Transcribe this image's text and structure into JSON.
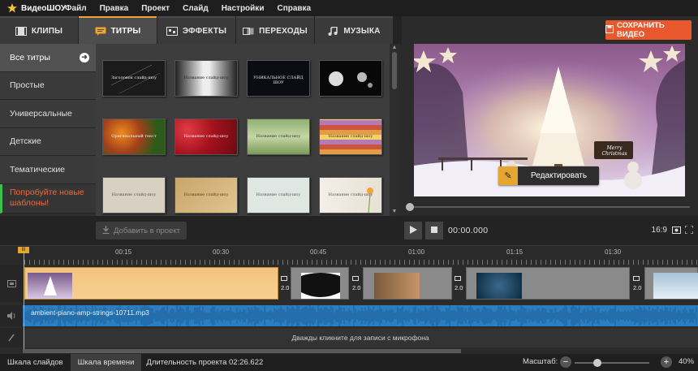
{
  "app": {
    "name": "ВидеоШОУ"
  },
  "menu": [
    "Файл",
    "Правка",
    "Проект",
    "Слайд",
    "Настройки",
    "Справка"
  ],
  "tabs": [
    {
      "label": "КЛИПЫ",
      "icon": "film-icon"
    },
    {
      "label": "ТИТРЫ",
      "icon": "titles-icon",
      "active": true
    },
    {
      "label": "ЭФФЕКТЫ",
      "icon": "effects-icon"
    },
    {
      "label": "ПЕРЕХОДЫ",
      "icon": "transitions-icon"
    },
    {
      "label": "МУЗЫКА",
      "icon": "music-icon"
    }
  ],
  "save_button": "СОХРАНИТЬ ВИДЕО",
  "categories": [
    {
      "label": "Все титры",
      "selected": true
    },
    {
      "label": "Простые"
    },
    {
      "label": "Универсальные"
    },
    {
      "label": "Детские"
    },
    {
      "label": "Тематические"
    },
    {
      "label": "Попробуйте новые шаблоны!",
      "promo": true
    }
  ],
  "thumbnails": [
    {
      "text": "Заголовок слайд-шоу"
    },
    {
      "text": "Название слайд-шоу"
    },
    {
      "text": "УНИКАЛЬНОЕ СЛАЙД ШОУ"
    },
    {
      "text": ""
    },
    {
      "text": "Оригинальный текст"
    },
    {
      "text": "Название слайд-шоу"
    },
    {
      "text": "Название слайд-шоу"
    },
    {
      "text": "Название слайд-шоу"
    },
    {
      "text": "Название слайд-шоу"
    },
    {
      "text": "Название слайд-шоу"
    },
    {
      "text": "Название слайд-шоу"
    },
    {
      "text": "Название слайд-шоу"
    }
  ],
  "add_button": "Добавить в проект",
  "preview": {
    "edit_button": "Редактировать",
    "sign_text": "Merry Christmas"
  },
  "transport": {
    "timecode": "00:00.000",
    "ratio": "16:9"
  },
  "timeline": {
    "marks": [
      "00:15",
      "00:30",
      "00:45",
      "01:00",
      "01:15",
      "01:30"
    ],
    "durations": [
      "2.0",
      "2.0",
      "2.0",
      "2.0"
    ],
    "audio_file": "ambient-piano-amp-strings-10711.mp3",
    "mic_hint": "Дважды кликните для записи с микрофона"
  },
  "status": {
    "tab_slides": "Шкала слайдов",
    "tab_timeline": "Шкала времени",
    "duration": "Длительность проекта 02:26.622",
    "zoom_label": "Масштаб:",
    "zoom_value": "40%"
  },
  "colors": {
    "accent": "#e5a531",
    "save": "#e9572c",
    "audio": "#2b7fc0",
    "promo": "#f4673c"
  }
}
